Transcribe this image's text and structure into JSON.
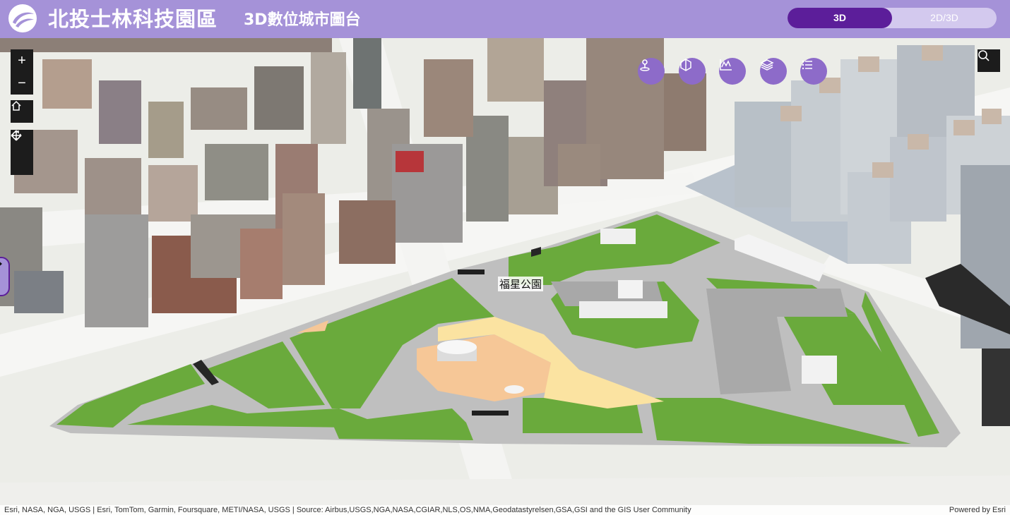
{
  "header": {
    "title": "北投士林科技園區",
    "subtitle": "3D數位城市圖台",
    "mode_3d": "3D",
    "mode_2d3d": "2D/3D"
  },
  "map": {
    "park_label": "福星公園",
    "attribution": "Esri, NASA, NGA, USGS | Esri, TomTom, Garmin, Foursquare, METI/NASA, USGS | Source: Airbus,USGS,NGA,NASA,CGIAR,NLS,OS,NMA,Geodatastyrelsen,GSA,GSI and the GIS User Community",
    "powered_by": "Powered by Esri"
  },
  "controls": {
    "zoom_in": "+",
    "zoom_out": "−",
    "icons": [
      "zoom-in-icon",
      "zoom-out-icon",
      "home-icon",
      "pan-icon",
      "rotate-icon",
      "search-icon"
    ]
  },
  "tools": [
    "location-icon",
    "cube-icon",
    "chart-icon",
    "layers-icon",
    "list-icon"
  ],
  "colors": {
    "header_bg": "#a592d8",
    "accent": "#5c1e9a",
    "tool_button": "#8d6bc9",
    "grass": "#6aaa3c",
    "path": "#b9b9b9",
    "sand": "#f6cf95"
  }
}
